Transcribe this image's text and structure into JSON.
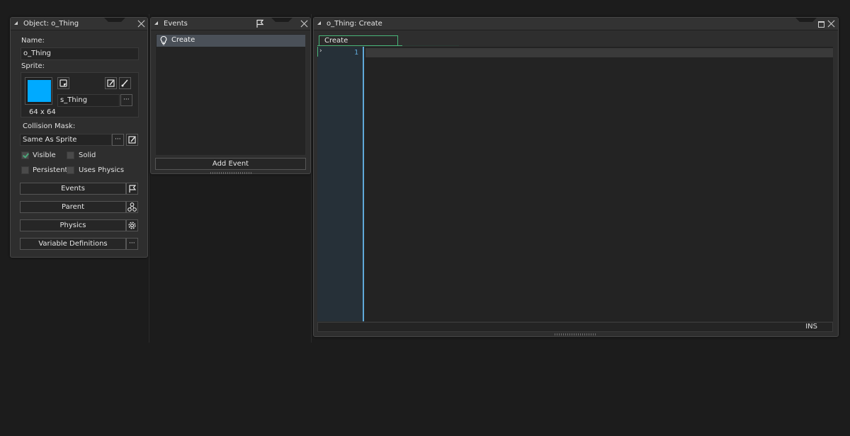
{
  "object_panel": {
    "title": "Object: o_Thing",
    "name_label": "Name:",
    "name_value": "o_Thing",
    "sprite_label": "Sprite:",
    "sprite_color": "#00aaff",
    "sprite_name": "s_Thing",
    "sprite_size": "64 x 64",
    "collision_label": "Collision Mask:",
    "collision_value": "Same As Sprite",
    "more_glyph": "···",
    "checks": {
      "visible": "Visible",
      "solid": "Solid",
      "persistent": "Persistent",
      "uses_physics": "Uses Physics"
    },
    "visible_checked": true,
    "solid_checked": false,
    "persistent_checked": false,
    "uses_physics_checked": false,
    "buttons": {
      "events": "Events",
      "parent": "Parent",
      "physics": "Physics",
      "variable_definitions": "Variable Definitions"
    }
  },
  "events_panel": {
    "title": "Events",
    "items": [
      {
        "label": "Create",
        "icon": "lightbulb-icon"
      }
    ],
    "add_event_label": "Add Event"
  },
  "code_panel": {
    "title": "o_Thing: Create",
    "tab_label": "Create",
    "line_number": "1",
    "status_mode": "INS"
  },
  "colors": {
    "accent_green": "#49b57a",
    "line_number_blue": "#5fa8d8",
    "gutter_bg": "#263038",
    "selected_event_bg": "#4a5058"
  }
}
